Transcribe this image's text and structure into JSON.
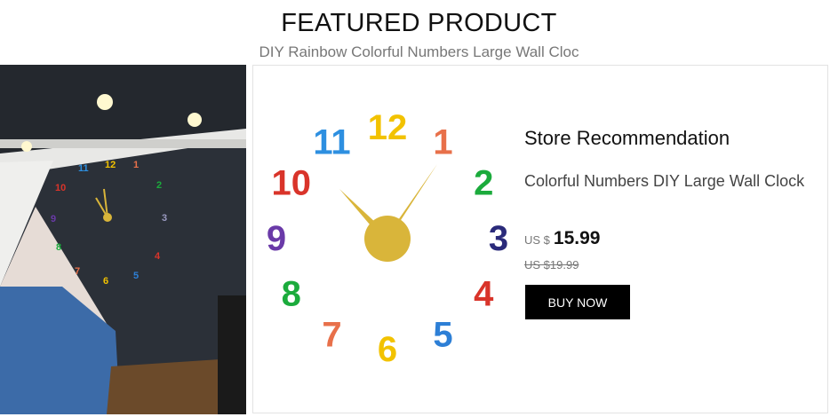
{
  "header": {
    "title": "FEATURED PRODUCT",
    "subtitle": "DIY Rainbow Colorful Numbers Large Wall Cloc"
  },
  "clock": {
    "numerals": [
      "12",
      "1",
      "2",
      "3",
      "4",
      "5",
      "6",
      "7",
      "8",
      "9",
      "10",
      "11"
    ],
    "numeral_colors": [
      "#f2c200",
      "#e8704a",
      "#1bab3c",
      "#2a2a7a",
      "#d9342a",
      "#2d7fd6",
      "#f2c200",
      "#e8704a",
      "#1bab3c",
      "#6a3aa8",
      "#d9342a",
      "#2d8fe0"
    ],
    "hand_color": "#d9b53a"
  },
  "product": {
    "section_title": "Store Recommendation",
    "name": "Colorful Numbers DIY Large Wall Clock",
    "currency": "US $",
    "price": "15.99",
    "old_price": "US $19.99",
    "buy_label": "BUY NOW"
  }
}
